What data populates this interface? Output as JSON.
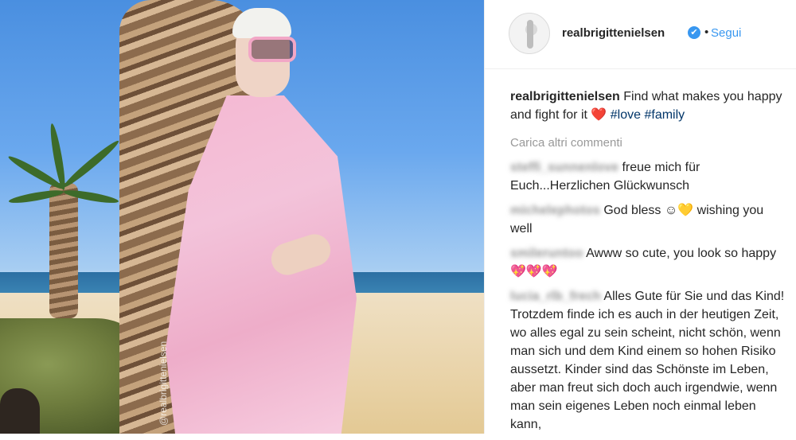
{
  "photo": {
    "watermark": "@realbrigittenielsen"
  },
  "post": {
    "username": "realbrigittenielsen",
    "verified_glyph": "✔",
    "separator": "•",
    "follow_label": "Segui"
  },
  "caption": {
    "user": "realbrigittenielsen",
    "text": " Find what makes you happy and fight for it ",
    "emoji": "❤️",
    "tags": [
      "#love",
      "#family"
    ]
  },
  "load_more": "Carica altri commenti",
  "comments": [
    {
      "user": "steffi_sunnenlove",
      "text_a": "freue mich für Euch...Herzlichen Glückwunsch",
      "emoji": "",
      "text_b": ""
    },
    {
      "user": "michelephotos",
      "text_a": "God bless ☺",
      "emoji": "💛",
      "text_b": "wishing you well"
    },
    {
      "user": "smileruntoo",
      "text_a": "Awww so cute, you look so happy ",
      "emoji": "💖💖💖",
      "text_b": ""
    },
    {
      "user": "lucia_rlb_frech",
      "text_a": "Alles Gute für Sie und das Kind! Trotzdem finde ich es auch in der heutigen Zeit, wo alles egal zu sein scheint, nicht schön, wenn man sich und dem Kind einem so hohen Risiko aussetzt. Kinder sind das Schönste im Leben, aber man freut sich doch auch irgendwie, wenn man sein eigenes Leben noch einmal leben kann,",
      "emoji": "",
      "text_b": ""
    }
  ],
  "colors": {
    "link_blue": "#3897f0",
    "hashtag": "#003569",
    "muted": "#999999",
    "text": "#262626"
  }
}
